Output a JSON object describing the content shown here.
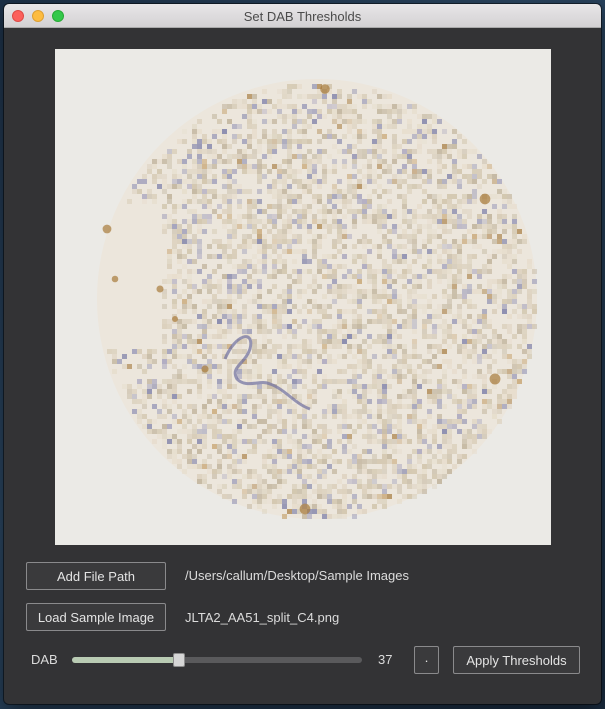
{
  "window": {
    "title": "Set DAB Thresholds"
  },
  "image": {
    "alt": "tissue-core-image"
  },
  "file_path": {
    "button_label": "Add File Path",
    "value": "/Users/callum/Desktop/Sample Images"
  },
  "sample": {
    "button_label": "Load Sample Image",
    "value": "JLTA2_AA51_split_C4.png"
  },
  "threshold": {
    "label": "DAB",
    "value": 37,
    "value_text": "37",
    "min": 0,
    "max": 100,
    "dot_button_label": "·",
    "apply_button_label": "Apply Thresholds"
  },
  "colors": {
    "window_bg": "#333335",
    "image_bg": "#ebeae6",
    "slider_fill": "#b9cbb3"
  }
}
